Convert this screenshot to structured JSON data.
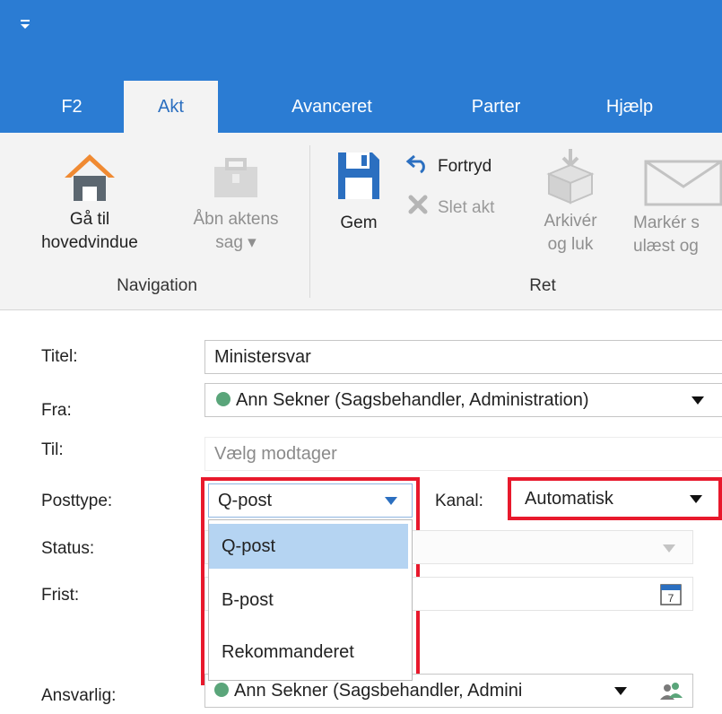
{
  "ribbon": {
    "tabs": [
      {
        "label": "F2",
        "active": false
      },
      {
        "label": "Akt",
        "active": true
      },
      {
        "label": "Avanceret",
        "active": false
      },
      {
        "label": "Parter",
        "active": false
      },
      {
        "label": "Hjælp",
        "active": false
      }
    ],
    "navigation": {
      "group_label": "Navigation",
      "goto_main_line1": "Gå til",
      "goto_main_line2": "hovedvindue",
      "open_case_line1": "Åbn aktens",
      "open_case_line2": "sag ▾"
    },
    "edit": {
      "group_label": "Ret",
      "save_label": "Gem",
      "undo_label": "Fortryd",
      "delete_label": "Slet akt",
      "archive_line1": "Arkivér",
      "archive_line2": "og luk",
      "mark_line1": "Markér s",
      "mark_line2": "ulæst og"
    }
  },
  "form": {
    "title_label": "Titel:",
    "title_value": "Ministersvar",
    "from_label": "Fra:",
    "from_value": "Ann Sekner (Sagsbehandler, Administration)",
    "to_label": "Til:",
    "to_placeholder": "Vælg modtager",
    "posttype_label": "Posttype:",
    "posttype_value": "Q-post",
    "channel_label": "Kanal:",
    "channel_value": "Automatisk",
    "status_label": "Status:",
    "deadline_label": "Frist:",
    "responsible_label": "Ansvarlig:",
    "responsible_value": "Ann Sekner (Sagsbehandler, Admini"
  },
  "posttype_dropdown": {
    "options": [
      "Q-post",
      "B-post",
      "Rekommanderet"
    ],
    "selected": "Q-post"
  },
  "colors": {
    "titlebar": "#2b7cd3",
    "highlight_box": "#e8192c",
    "selected_option": "#b5d4f2",
    "status_dot": "#5aa57a"
  }
}
